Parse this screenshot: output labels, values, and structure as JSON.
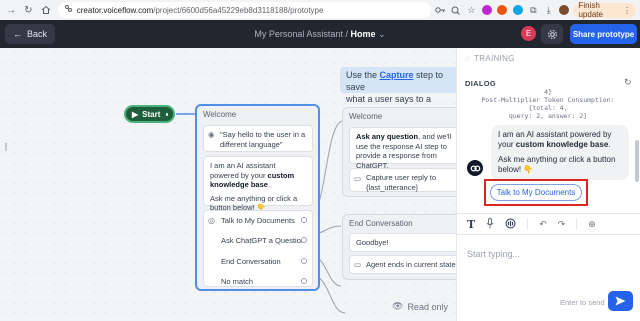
{
  "browser": {
    "url_host": "creator.voiceflow.com",
    "url_path": "/project/6600d56a45229eb8d3118188/prototype",
    "finish_update_label": "Finish update"
  },
  "appbar": {
    "back_label": "Back",
    "project_name": "My Personal Assistant",
    "separator": "/",
    "current_flow": "Home",
    "user_initial": "E",
    "share_label": "Share prototype"
  },
  "canvas": {
    "hint_prefix": "Use the ",
    "hint_link": "Capture",
    "hint_line1_suffix": " step to save",
    "hint_line2": "what a user says to a variable",
    "start_label": "Start",
    "welcome_block": {
      "title": "Welcome",
      "card1": "\"Say hello to the user in a different language\"",
      "card2_intro": "I am an AI assistant powered by your ",
      "card2_bold": "custom knowledge base",
      "card2_end": ".",
      "card2_line2": "Ask me anything or click a button below! 👇",
      "buttons": [
        "Talk to My Documents",
        "Ask ChatGPT a Question",
        "End Conversation",
        "No match"
      ]
    },
    "welcome_block_2": {
      "title": "Welcome",
      "card1_bold": "Ask any question",
      "card1_rest": ", and we'll use the response AI step to provide a response from ChatGPT.",
      "card2": "Capture user reply to {last_utterance}"
    },
    "end_block": {
      "title": "End Conversation",
      "card1": "Goodbye!",
      "card2": "Agent ends in current state"
    },
    "readonly_label": "Read only"
  },
  "panel": {
    "training_label": "TRAINING",
    "dialog_label": "DIALOG",
    "trace_line1": "4}",
    "trace_line2": "Post-Multiplier Token Consumption: {total: 4,",
    "trace_line3": "query: 2, answer: 2}",
    "bot_msg_intro": "I am an AI assistant powered by your ",
    "bot_msg_bold": "custom knowledge base",
    "bot_msg_end": ".",
    "bot_msg_line2": "Ask me anything or click a button below! 👇",
    "choice_button": "Talk to My Documents",
    "input_placeholder": "Start typing...",
    "enter_hint": "Enter to send"
  },
  "colors": {
    "accent": "#2563eb",
    "appbar_bg": "#22262f",
    "start_node": "#1f5e3b",
    "highlight": "#dc2626",
    "selected_block": "#4f8fe8"
  }
}
